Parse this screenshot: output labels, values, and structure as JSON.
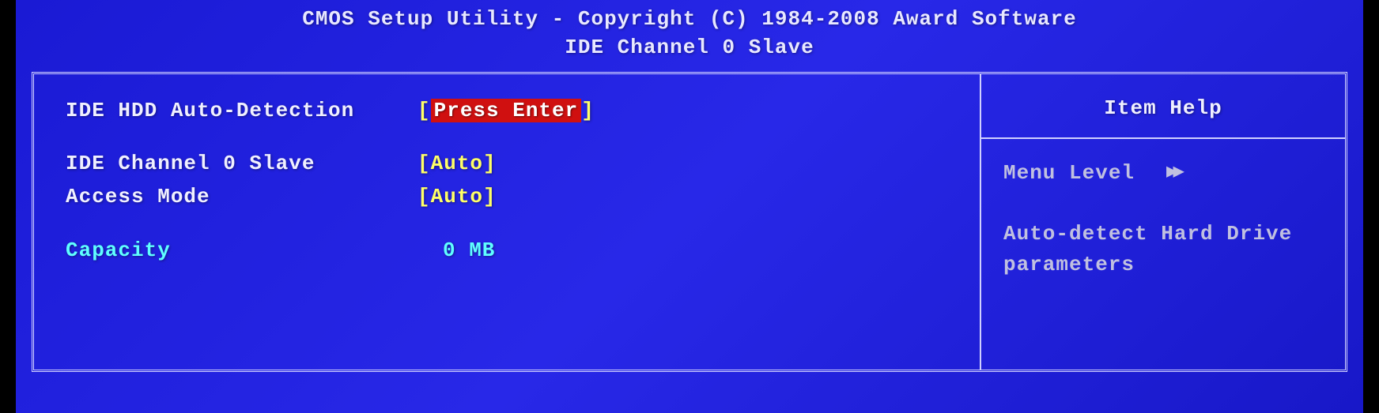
{
  "header": {
    "title": "CMOS Setup Utility - Copyright (C) 1984-2008 Award Software",
    "subtitle": "IDE Channel 0 Slave"
  },
  "settings": {
    "autoDetect": {
      "label": "IDE HDD Auto-Detection",
      "value": "Press Enter"
    },
    "channel": {
      "label": "IDE Channel 0 Slave",
      "value": "Auto"
    },
    "accessMode": {
      "label": "Access Mode",
      "value": "Auto"
    },
    "capacity": {
      "label": "Capacity",
      "value": "0 MB"
    }
  },
  "help": {
    "title": "Item Help",
    "menuLevelLabel": "Menu Level",
    "description": "Auto-detect Hard Drive parameters"
  }
}
